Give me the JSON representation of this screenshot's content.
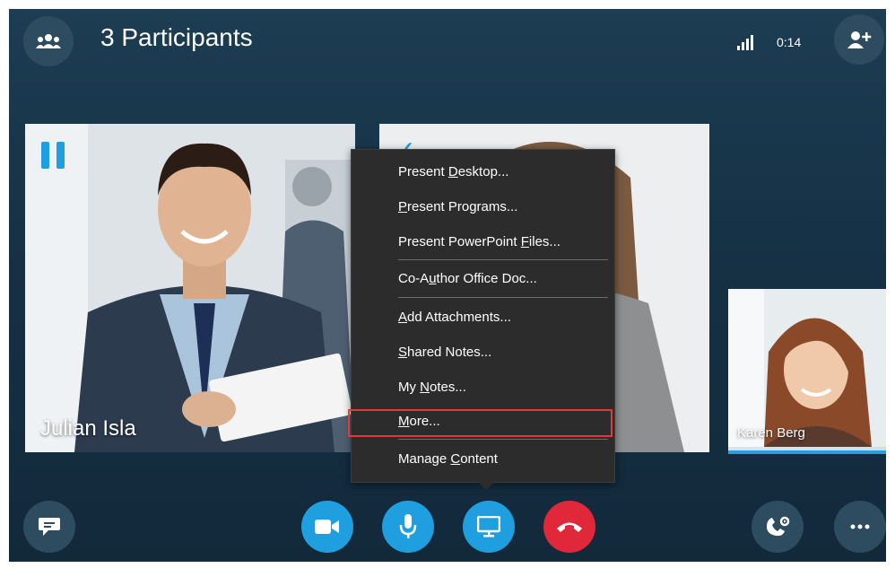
{
  "header": {
    "participants_label": "3 Participants",
    "call_timer": "0:14",
    "icons": [
      "participants-icon",
      "signal-bars-icon",
      "add-person-icon"
    ]
  },
  "videos": {
    "main_participant_name": "Julian Isla",
    "thumbnail_participant_name": "Karen Berg"
  },
  "menu": {
    "items": [
      {
        "label": "Present Desktop...",
        "access": "D"
      },
      {
        "label": "Present Programs...",
        "access": "P"
      },
      {
        "label": "Present PowerPoint Files...",
        "access": "F"
      },
      {
        "label": "Co-Author Office Doc...",
        "access": "u"
      },
      {
        "label": "Add Attachments...",
        "access": "A"
      },
      {
        "label": "Shared Notes...",
        "access": "S"
      },
      {
        "label": "My Notes...",
        "access": "N"
      },
      {
        "label": "More...",
        "access": "M",
        "highlighted": true
      },
      {
        "label": "Manage Content",
        "access": "C"
      }
    ]
  },
  "controls": {
    "icons": [
      "chat-icon",
      "video-camera-icon",
      "microphone-icon",
      "present-screen-icon",
      "hang-up-icon",
      "call-controls-icon",
      "more-options-icon"
    ],
    "colors": {
      "accent_blue": "#1f9fe0",
      "hang_up_red": "#e0283a",
      "highlight_red": "#e0393e"
    }
  }
}
